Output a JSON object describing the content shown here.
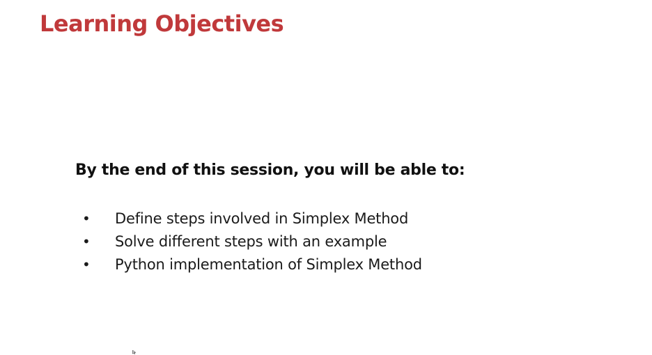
{
  "slide": {
    "title": "Learning Objectives",
    "title_color": "#c0393b",
    "lead": "By the end of this session, you will be able to:",
    "bullet_char": "•",
    "objectives": [
      "Define steps involved in Simplex Method",
      "Solve different steps with an example",
      "Python implementation of Simplex Method"
    ]
  },
  "cursor": {
    "icon": "mouse-pointer-icon"
  }
}
